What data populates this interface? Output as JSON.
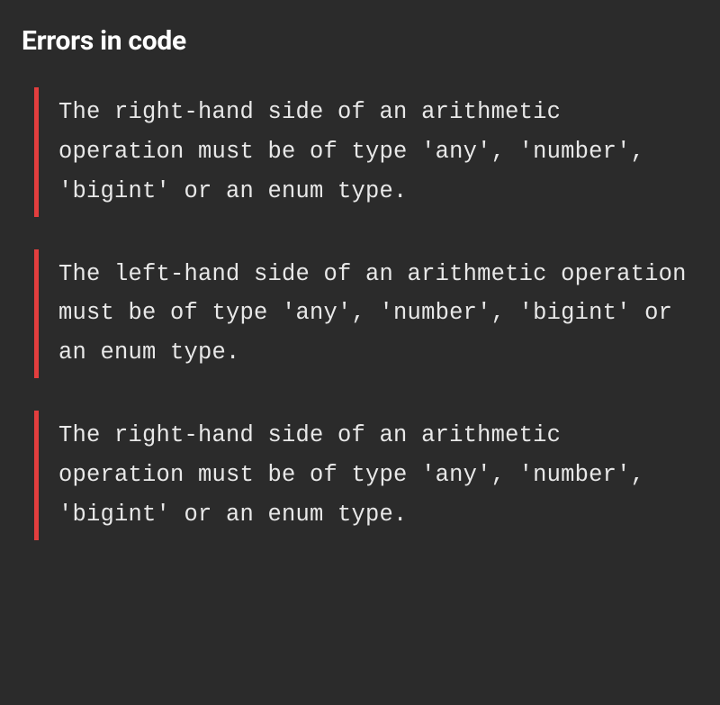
{
  "panel": {
    "title": "Errors in code",
    "errors": [
      {
        "message": "The right-hand side of an arithmetic operation must be of type 'any', 'number', 'bigint' or an enum type."
      },
      {
        "message": "The left-hand side of an arithmetic operation must be of type 'any', 'number', 'bigint' or an enum type."
      },
      {
        "message": "The right-hand side of an arithmetic operation must be of type 'any', 'number', 'bigint' or an enum type."
      }
    ]
  }
}
